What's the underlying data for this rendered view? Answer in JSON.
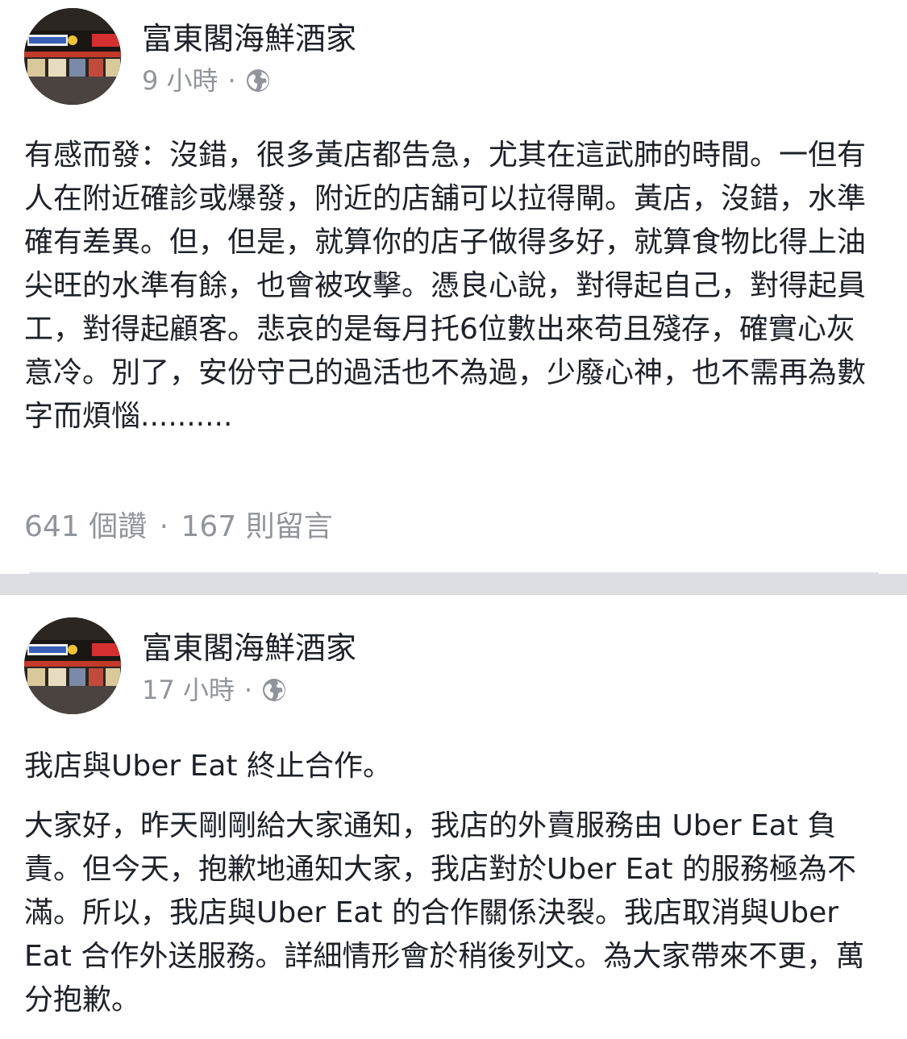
{
  "posts": [
    {
      "page_name": "富東閣海鮮酒家",
      "time": "9 小時",
      "dot": "·",
      "privacy_icon": "globe-icon",
      "paragraphs": [
        "有感而發：沒錯，很多黃店都告急，尤其在這武肺的時間。一但有人在附近確診或爆發，附近的店舖可以拉得閘。黃店，沒錯，水準確有差異。但，但是，就算你的店子做得多好，就算食物比得上油尖旺的水準有餘，也會被攻擊。憑良心說，對得起自己，對得起員工，對得起顧客。悲哀的是每月托6位數出來苟且殘存，確實心灰意冷。別了，安份守己的過活也不為過，少廢心神，也不需再為數字而煩惱.........."
      ],
      "likes": "641 個讚",
      "sep": "·",
      "comments": "167 則留言"
    },
    {
      "page_name": "富東閣海鮮酒家",
      "time": "17 小時",
      "dot": "·",
      "privacy_icon": "globe-icon",
      "paragraphs": [
        "我店與Uber Eat 終止合作。",
        "大家好，昨天剛剛給大家通知，我店的外賣服務由 Uber Eat 負責。但今天，抱歉地通知大家，我店對於Uber Eat 的服務極為不滿。所以，我店與Uber Eat 的合作關係決裂。我店取消與Uber Eat 合作外送服務。詳細情形會於稍後列文。為大家帶來不更，萬分抱歉。"
      ]
    }
  ],
  "colors": {
    "text": "#1d2129",
    "meta": "#90949c",
    "divider": "#dcdee3"
  }
}
